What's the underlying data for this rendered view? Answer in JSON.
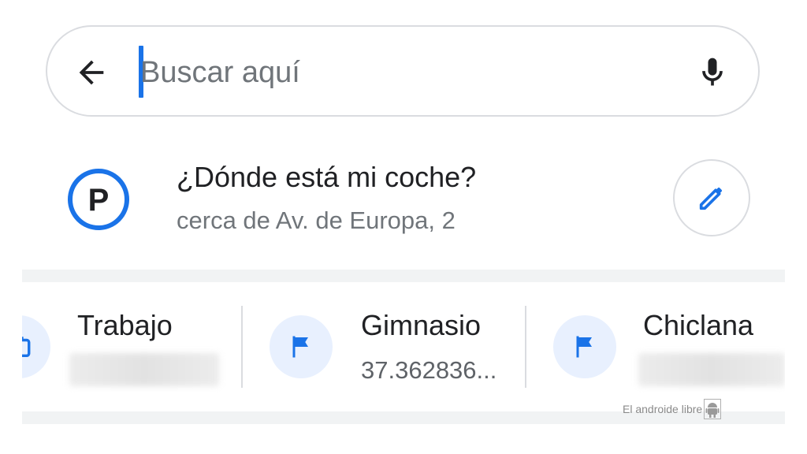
{
  "search": {
    "placeholder": "Buscar aquí",
    "value": ""
  },
  "parking": {
    "title": "¿Dónde está mi coche?",
    "subtitle": "cerca de Av. de Europa, 2"
  },
  "places": [
    {
      "name": "Trabajo",
      "subtitle": "",
      "icon": "briefcase-icon"
    },
    {
      "name": "Gimnasio",
      "subtitle": "37.362836...",
      "icon": "flag-icon"
    },
    {
      "name": "Chiclana",
      "subtitle": "",
      "icon": "flag-icon"
    }
  ],
  "watermark": "El androide libre",
  "colors": {
    "accent": "#1a73e8",
    "icon_bg": "#e8f0fe",
    "text_primary": "#202124",
    "text_secondary": "#70757a",
    "border": "#dadce0"
  },
  "icons": {
    "back": "arrow-left-icon",
    "mic": "microphone-icon",
    "parking": "parking-icon",
    "edit": "pencil-icon"
  }
}
